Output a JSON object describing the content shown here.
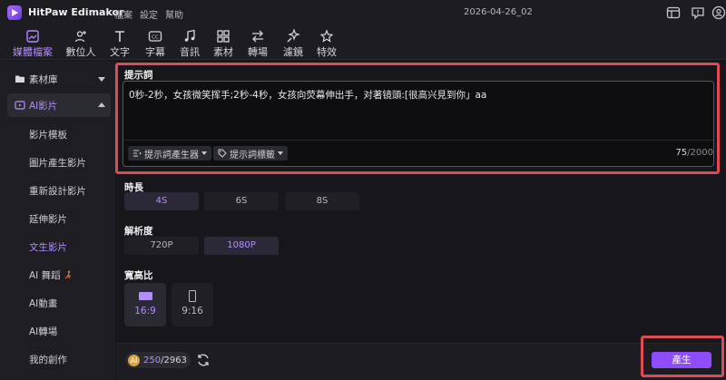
{
  "app": {
    "title": "HitPaw Edimakor",
    "menu": [
      "檔案",
      "設定",
      "幫助"
    ],
    "project_title": "2026-04-26_02"
  },
  "toolbar": {
    "tools": [
      {
        "label": "媒體檔案",
        "icon": "media-icon",
        "active": true
      },
      {
        "label": "數位人",
        "icon": "avatar-plus-icon"
      },
      {
        "label": "文字",
        "icon": "text-icon"
      },
      {
        "label": "字幕",
        "icon": "subtitle-icon"
      },
      {
        "label": "音訊",
        "icon": "music-icon"
      },
      {
        "label": "素材",
        "icon": "grid-icon"
      },
      {
        "label": "轉場",
        "icon": "transition-icon"
      },
      {
        "label": "濾鏡",
        "icon": "sparkle-icon"
      },
      {
        "label": "特效",
        "icon": "effect-icon"
      }
    ]
  },
  "sidebar": {
    "library_label": "素材庫",
    "ai_video_label": "AI影片",
    "items": [
      "影片模板",
      "圖片產生影片",
      "重新設計影片",
      "延伸影片",
      "文生影片",
      "AI 舞蹈",
      "AI動畫",
      "AI轉場",
      "我的創作"
    ],
    "active_item": "文生影片"
  },
  "prompt": {
    "label": "提示詞",
    "text": "0秒-2秒，女孩微笑挥手;2秒-4秒，女孩向荧幕伸出手，对著镜頭:[很高兴見到你」aa",
    "generator_chip": "提示詞產生器",
    "tags_chip": "提示詞標籤",
    "count": "75",
    "max": "/2000"
  },
  "duration": {
    "label": "時長",
    "options": [
      "4S",
      "6S",
      "8S"
    ],
    "selected": "4S"
  },
  "resolution": {
    "label": "解析度",
    "options": [
      "720P",
      "1080P"
    ],
    "selected": "1080P"
  },
  "aspect": {
    "label": "寬高比",
    "options": [
      "16:9",
      "9:16"
    ],
    "selected": "16:9"
  },
  "footer": {
    "credits_used": "250",
    "credits_total": "/2963",
    "generate_label": "產生"
  },
  "colors": {
    "accent": "#b58cff",
    "button": "#8d4dfb",
    "highlight": "#e04a55"
  }
}
